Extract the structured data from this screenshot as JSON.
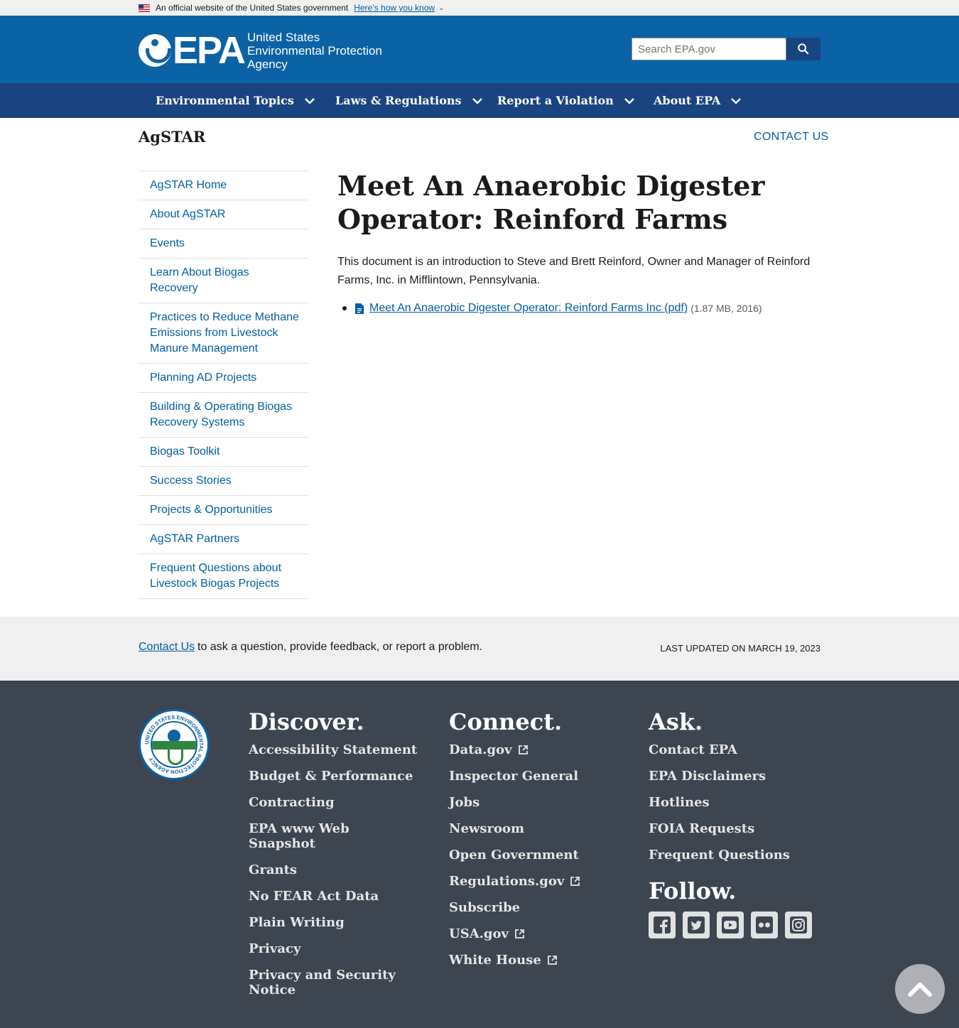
{
  "gov_banner": {
    "official_text": "An official website of the United States government",
    "how_link": "Here’s how you know"
  },
  "header": {
    "logo_acronym": "EPA",
    "logo_lines": [
      "United States",
      "Environmental Protection",
      "Agency"
    ],
    "search_placeholder": "Search EPA.gov"
  },
  "nav": {
    "items": [
      {
        "label": "Environmental Topics"
      },
      {
        "label": "Laws & Regulations"
      },
      {
        "label": "Report a Violation"
      },
      {
        "label": "About EPA"
      }
    ]
  },
  "page": {
    "site_title": "AgSTAR",
    "contact_us": "CONTACT US",
    "title": "Meet An Anaerobic Digester Operator: Reinford Farms",
    "intro": "This document is an introduction to Steve and Brett Reinford, Owner and Manager of Reinford Farms, Inc. in Mifflintown, Pennsylvania.",
    "document": {
      "link_text": "Meet An Anaerobic Digester Operator: Reinford Farms Inc (pdf)",
      "meta": "(1.87 MB, 2016)"
    }
  },
  "sidebar": {
    "items": [
      {
        "label": "AgSTAR Home"
      },
      {
        "label": "About AgSTAR"
      },
      {
        "label": "Events"
      },
      {
        "label": "Learn About Biogas Recovery"
      },
      {
        "label": "Practices to Reduce Methane Emissions from Livestock Manure Management"
      },
      {
        "label": "Planning AD Projects"
      },
      {
        "label": "Building & Operating Biogas Recovery Systems"
      },
      {
        "label": "Biogas Toolkit"
      },
      {
        "label": "Success Stories"
      },
      {
        "label": "Projects & Opportunities"
      },
      {
        "label": "AgSTAR Partners"
      },
      {
        "label": "Frequent Questions about Livestock Biogas Projects"
      }
    ]
  },
  "feedback": {
    "contact_link": "Contact Us",
    "tail_text": "to ask a question, provide feedback, or report a problem.",
    "last_updated": "LAST UPDATED ON MARCH 19, 2023"
  },
  "footer": {
    "seal_text": "UNITED STATES ENVIRONMENTAL PROTECTION AGENCY",
    "discover": {
      "heading": "Discover.",
      "links": [
        "Accessibility Statement",
        "Budget & Performance",
        "Contracting",
        "EPA www Web Snapshot",
        "Grants",
        "No FEAR Act Data",
        "Plain Writing",
        "Privacy",
        "Privacy and Security Notice"
      ]
    },
    "connect": {
      "heading": "Connect.",
      "links": [
        {
          "label": "Data.gov",
          "external": true
        },
        {
          "label": "Inspector General",
          "external": false
        },
        {
          "label": "Jobs",
          "external": false
        },
        {
          "label": "Newsroom",
          "external": false
        },
        {
          "label": "Open Government",
          "external": false
        },
        {
          "label": "Regulations.gov",
          "external": true
        },
        {
          "label": "Subscribe",
          "external": false
        },
        {
          "label": "USA.gov",
          "external": true
        },
        {
          "label": "White House",
          "external": true
        }
      ]
    },
    "ask": {
      "heading": "Ask.",
      "links": [
        "Contact EPA",
        "EPA Disclaimers",
        "Hotlines",
        "FOIA Requests",
        "Frequent Questions"
      ]
    },
    "follow": {
      "heading": "Follow.",
      "icons": [
        "facebook-icon",
        "twitter-icon",
        "youtube-icon",
        "flickr-icon",
        "instagram-icon"
      ]
    }
  },
  "colors": {
    "header_blue": "#0b62a4",
    "nav_blue": "#1a4480",
    "link_blue": "#005ea2",
    "footer_bg": "#3d4551"
  }
}
